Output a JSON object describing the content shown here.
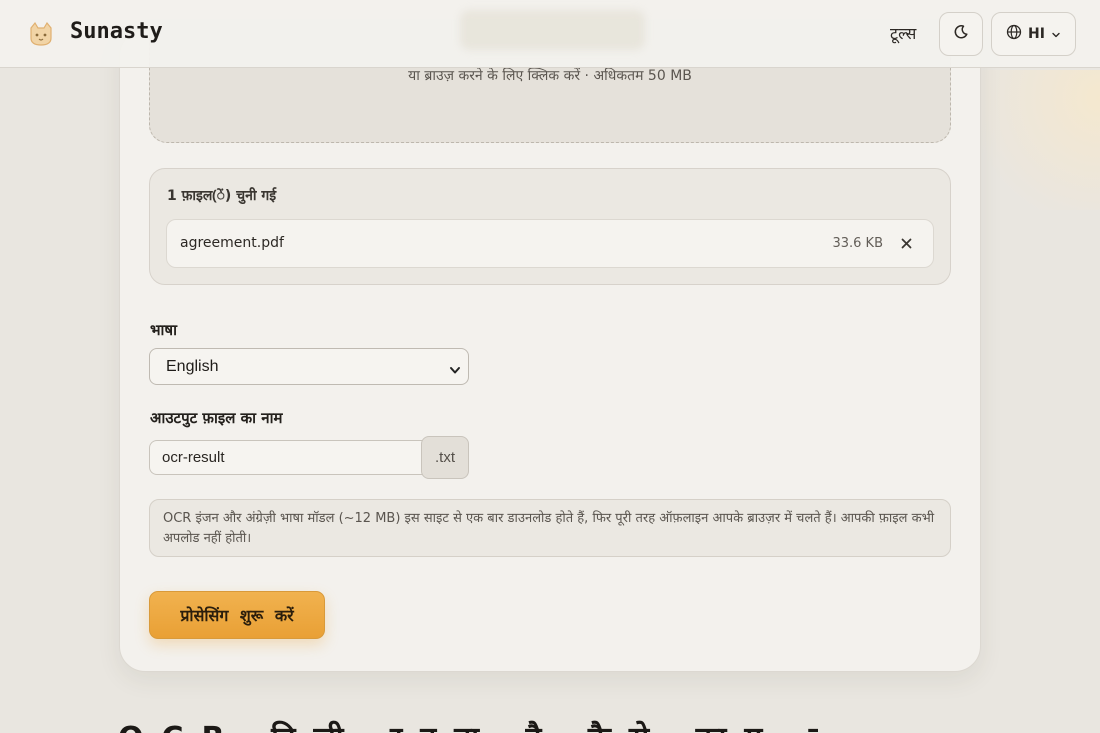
{
  "header": {
    "brand_name": "Sunasty",
    "nav_tools": "टूल्स",
    "language_code": "HI",
    "icons": [
      "cat-logo-icon",
      "moon-icon",
      "globe-icon",
      "chevron-down-icon"
    ]
  },
  "dropzone": {
    "hint": "या ब्राउज़ करने के लिए क्लिक करें · अधिकतम 50 MB"
  },
  "files": {
    "count_label": "1 फ़ाइल(ें) चुनी गई",
    "items": [
      {
        "name": "agreement.pdf",
        "size": "33.6 KB"
      }
    ]
  },
  "language": {
    "label": "भाषा",
    "selected": "English"
  },
  "output": {
    "label": "आउटपुट फ़ाइल का नाम",
    "value": "ocr-result",
    "extension": ".txt"
  },
  "info_note": "OCR इंजन और अंग्रेज़ी भाषा मॉडल (~12 MB) इस साइट से एक बार डाउनलोड होते हैं, फिर पूरी तरह ऑफ़लाइन आपके ब्राउज़र में चलते हैं। आपकी फ़ाइल कभी अपलोड नहीं होती।",
  "start_button": "प्रोसेसिंग शुरू करें",
  "below_heading": "OCR निजी रहता है कैसे काम करता है",
  "colors": {
    "accent": "#eea842",
    "background": "#e9e6e0",
    "card": "#f3f1ed"
  }
}
